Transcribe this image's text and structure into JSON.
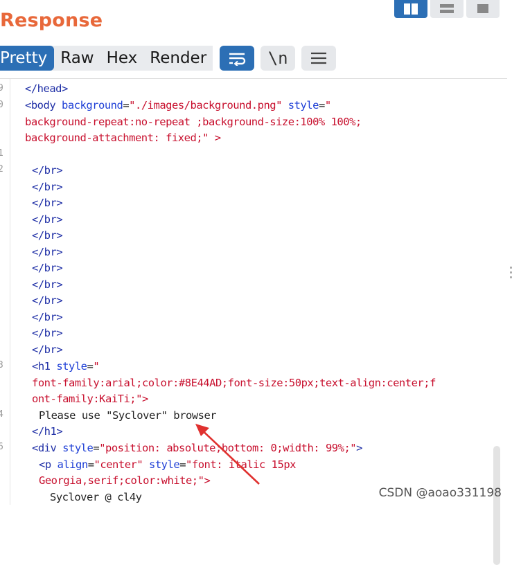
{
  "panel": {
    "title": "Response"
  },
  "view_tabs": [
    "Pretty",
    "Raw",
    "Hex",
    "Render"
  ],
  "toolbar": {
    "wrap_icon": "wrap-lines-icon",
    "newline_label": "\\n",
    "menu_icon": "hamburger-menu-icon"
  },
  "layout_buttons": [
    "split-view-icon",
    "horizontal-view-icon",
    "single-view-icon"
  ],
  "gutter": [
    "9",
    "0",
    "1",
    "2",
    "3",
    "4",
    "6"
  ],
  "code": {
    "l1": {
      "a": "</",
      "b": "head",
      "c": ">"
    },
    "l2": {
      "a": "<",
      "b": "body",
      "c": " background",
      "d": "=",
      "e": "\"./images/background.png\"",
      "f": " style",
      "g": "=",
      "h": "\""
    },
    "l3": "background-repeat:no-repeat ;background-size:100% 100%;",
    "l4": "background-attachment: fixed;\" >",
    "br": "</br>",
    "br_count": 12,
    "h1_open": {
      "a": "<",
      "b": "h1",
      "c": " style",
      "d": "=",
      "e": "\""
    },
    "h1_style_1": "font-family:arial;color:#8E44AD;font-size:50px;text-align:center;f",
    "h1_style_2": "ont-family:KaiTi;\">",
    "h1_text": "Please use \"Syclover\" browser",
    "h1_close": {
      "a": "</",
      "b": "h1",
      "c": ">"
    },
    "div_open": {
      "a": "<",
      "b": "div",
      "c": " style",
      "d": "=",
      "e": "\"position: absolute;bottom: 0;width: 99%;\"",
      "f": ">"
    },
    "p_open": {
      "a": "<",
      "b": "p",
      "c": " align",
      "d": "=",
      "e": "\"center\"",
      "f": " style",
      "g": "=",
      "h": "\"font: italic 15px"
    },
    "p_style_2": "Georgia,serif;color:white;\">",
    "p_text": "Syclover @ cl4y"
  },
  "watermark": "CSDN @aoao331198",
  "colors": {
    "accent": "#2c6fb5",
    "title": "#e8683a",
    "tag": "#1f2fa6",
    "string": "#c8102e",
    "arrow": "#e0312f"
  }
}
